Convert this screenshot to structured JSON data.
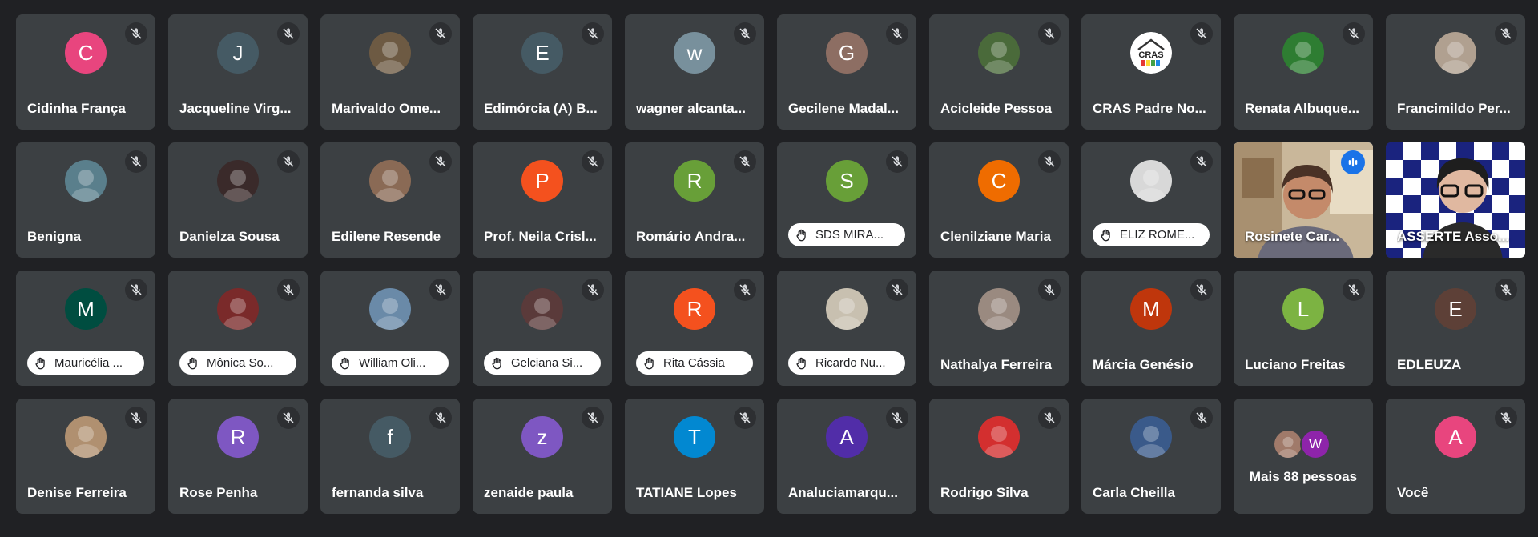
{
  "participants": [
    {
      "name": "Cidinha França",
      "initial": "C",
      "color": "#e8457e",
      "type": "letter"
    },
    {
      "name": "Jacqueline Virg...",
      "initial": "J",
      "color": "#455a64",
      "type": "letter"
    },
    {
      "name": "Marivaldo Ome...",
      "type": "photo",
      "photo": "#6d5a43"
    },
    {
      "name": "Edimórcia (A) B...",
      "initial": "E",
      "color": "#455a64",
      "type": "letter"
    },
    {
      "name": "wagner alcanta...",
      "initial": "w",
      "color": "#78909c",
      "type": "letter"
    },
    {
      "name": "Gecilene Madal...",
      "initial": "G",
      "color": "#8d6e63",
      "type": "letter"
    },
    {
      "name": "Acicleide Pessoa",
      "type": "photo",
      "photo": "#4a6a3a"
    },
    {
      "name": "CRAS Padre No...",
      "type": "photo",
      "photo": "#ffffff",
      "logo_text": "CRAS"
    },
    {
      "name": "Renata Albuque...",
      "type": "photo",
      "photo": "#2e7d32"
    },
    {
      "name": "Francimildo Per...",
      "type": "photo",
      "photo": "#b0a090"
    },
    {
      "name": "Benigna",
      "type": "photo",
      "photo": "#5a7f8c"
    },
    {
      "name": "Danielza Sousa",
      "type": "photo",
      "photo": "#3a2a2a"
    },
    {
      "name": "Edilene Resende",
      "type": "photo",
      "photo": "#8a6a55"
    },
    {
      "name": "Prof. Neila Crisl...",
      "initial": "P",
      "color": "#f4511e",
      "type": "letter"
    },
    {
      "name": "Romário Andra...",
      "initial": "R",
      "color": "#689f38",
      "type": "letter"
    },
    {
      "name": "SDS MIRA...",
      "initial": "S",
      "color": "#689f38",
      "type": "letter",
      "hand": true
    },
    {
      "name": "Clenilziane Maria",
      "initial": "C",
      "color": "#ef6c00",
      "type": "letter"
    },
    {
      "name": "ELIZ ROME...",
      "type": "photo",
      "photo": "#d8d8d8",
      "hand": true
    },
    {
      "name": "Rosinete Car...",
      "type": "video",
      "speaking": true
    },
    {
      "name": "ASSERTE Asso...",
      "type": "video2"
    },
    {
      "name": "Mauricélia ...",
      "initial": "M",
      "color": "#004d40",
      "type": "letter",
      "hand": true
    },
    {
      "name": "Mônica So...",
      "type": "photo",
      "photo": "#7a2a2a",
      "hand": true
    },
    {
      "name": "William Oli...",
      "type": "photo",
      "photo": "#6a8aa8",
      "hand": true
    },
    {
      "name": "Gelciana Si...",
      "type": "photo",
      "photo": "#5a3a3a",
      "hand": true
    },
    {
      "name": "Rita Cássia",
      "initial": "R",
      "color": "#f4511e",
      "type": "letter",
      "hand": true
    },
    {
      "name": "Ricardo Nu...",
      "type": "photo",
      "photo": "#c8c0b0",
      "hand": true
    },
    {
      "name": "Nathalya Ferreira",
      "type": "photo",
      "photo": "#9a8a80"
    },
    {
      "name": "Márcia Genésio",
      "initial": "M",
      "color": "#bf360c",
      "type": "letter"
    },
    {
      "name": "Luciano Freitas",
      "initial": "L",
      "color": "#7cb342",
      "type": "letter"
    },
    {
      "name": "EDLEUZA",
      "initial": "E",
      "color": "#5d4037",
      "type": "letter"
    },
    {
      "name": "Denise Ferreira",
      "type": "photo",
      "photo": "#b09070"
    },
    {
      "name": "Rose Penha",
      "initial": "R",
      "color": "#7e57c2",
      "type": "letter"
    },
    {
      "name": "fernanda silva",
      "initial": "f",
      "color": "#455a64",
      "type": "letter"
    },
    {
      "name": "zenaide paula",
      "initial": "z",
      "color": "#7e57c2",
      "type": "letter"
    },
    {
      "name": "TATIANE Lopes",
      "initial": "T",
      "color": "#0288d1",
      "type": "letter"
    },
    {
      "name": "Analuciamarqu...",
      "initial": "A",
      "color": "#512da8",
      "type": "letter"
    },
    {
      "name": "Rodrigo Silva",
      "type": "photo",
      "photo": "#d32f2f"
    },
    {
      "name": "Carla Cheilla",
      "type": "photo",
      "photo": "#3a5a8a"
    },
    {
      "name": "Mais 88 pessoas",
      "type": "more",
      "mini_initial": "W",
      "mini_color": "#8e24aa"
    },
    {
      "name": "Você",
      "initial": "A",
      "color": "#e8457e",
      "type": "letter"
    }
  ],
  "colors": {
    "background": "#202124",
    "tile": "#3c4043",
    "active_border": "#8ab4f8"
  }
}
